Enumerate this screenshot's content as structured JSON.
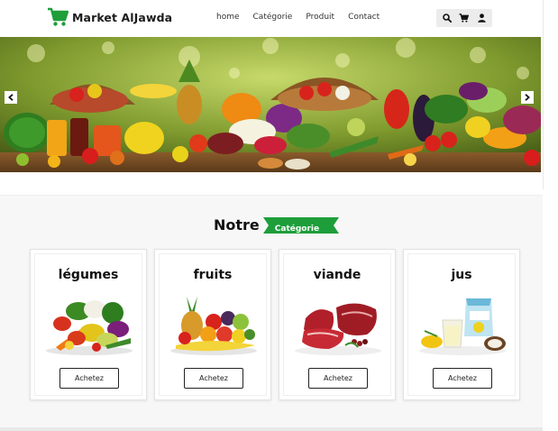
{
  "brand": {
    "name": "Market AlJawda",
    "icon": "shopping-cart-icon",
    "color": "#1e9e3a"
  },
  "nav": {
    "links": [
      {
        "label": "home"
      },
      {
        "label": "Catégorie"
      },
      {
        "label": "Produit"
      },
      {
        "label": "Contact"
      }
    ],
    "tools": [
      "search-icon",
      "cart-icon",
      "user-icon"
    ]
  },
  "hero": {
    "image": "fruits-and-vegetables-banner",
    "prev_icon": "chevron-left-icon",
    "next_icon": "chevron-right-icon"
  },
  "section": {
    "title_word": "Notre",
    "title_badge": "Catégorie",
    "badge_color": "#1e9e3a"
  },
  "categories": [
    {
      "title": "légumes",
      "button": "Achetez",
      "image": "vegetables-image"
    },
    {
      "title": "fruits",
      "button": "Achetez",
      "image": "fruits-image"
    },
    {
      "title": "viande",
      "button": "Achetez",
      "image": "meat-image"
    },
    {
      "title": "jus",
      "button": "Achetez",
      "image": "juice-image"
    }
  ]
}
